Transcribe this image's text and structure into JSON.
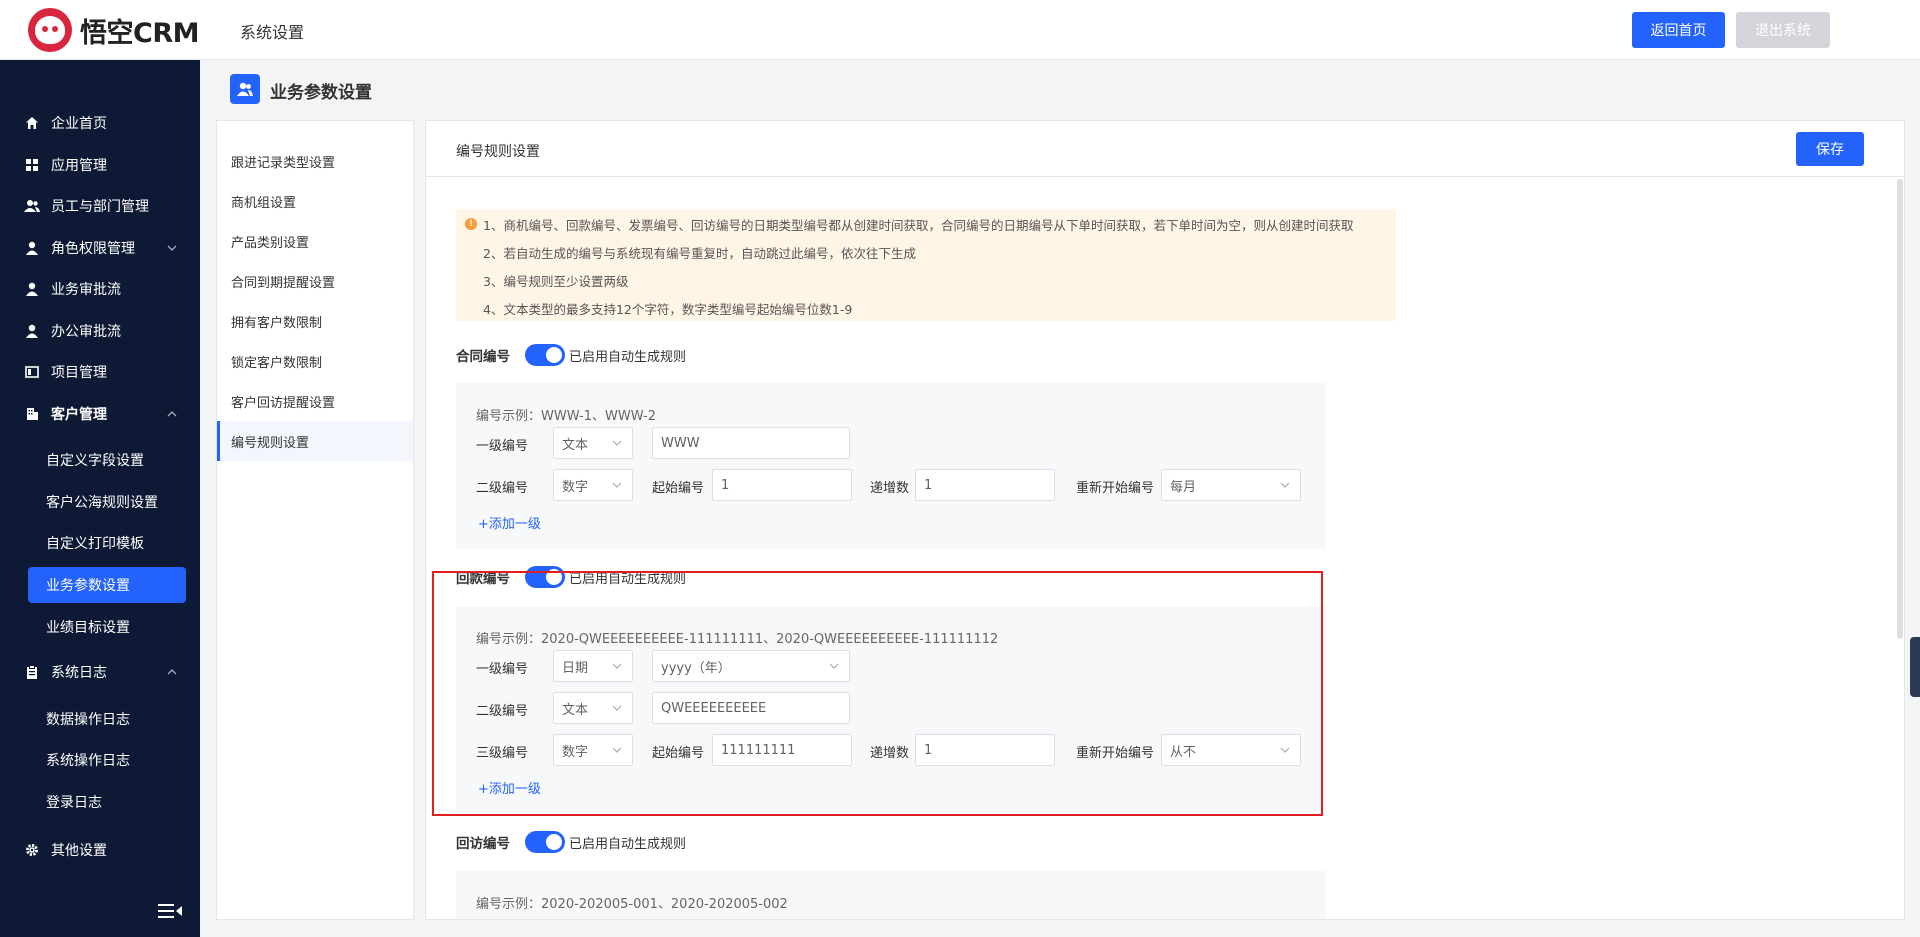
{
  "header": {
    "logo_text": "悟空CRM",
    "title": "系统设置",
    "back_label": "返回首页",
    "logout_label": "退出系统"
  },
  "sidebar": {
    "items": [
      {
        "label": "企业首页",
        "icon": "home-icon"
      },
      {
        "label": "应用管理",
        "icon": "grid-icon"
      },
      {
        "label": "员工与部门管理",
        "icon": "users-icon"
      },
      {
        "label": "角色权限管理",
        "icon": "user-icon"
      },
      {
        "label": "业务审批流",
        "icon": "user-icon"
      },
      {
        "label": "办公审批流",
        "icon": "user-icon"
      },
      {
        "label": "项目管理",
        "icon": "project-icon"
      },
      {
        "label": "客户管理",
        "icon": "building-icon"
      },
      {
        "label": "系统日志",
        "icon": "clipboard-icon"
      },
      {
        "label": "其他设置",
        "icon": "gear-icon"
      }
    ],
    "customer_sub": [
      "自定义字段设置",
      "客户公海规则设置",
      "自定义打印模板",
      "业务参数设置",
      "业绩目标设置"
    ],
    "log_sub": [
      "数据操作日志",
      "系统操作日志",
      "登录日志"
    ]
  },
  "page": {
    "title": "业务参数设置"
  },
  "settings_menu": [
    "跟进记录类型设置",
    "商机组设置",
    "产品类别设置",
    "合同到期提醒设置",
    "拥有客户数限制",
    "锁定客户数限制",
    "客户回访提醒设置",
    "编号规则设置"
  ],
  "panel": {
    "title": "编号规则设置",
    "save_label": "保存",
    "notice": [
      "1、商机编号、回款编号、发票编号、回访编号的日期类型编号都从创建时间获取，合同编号的日期编号从下单时间获取，若下单时间为空，则从创建时间获取",
      "2、若自动生成的编号与系统现有编号重复时，自动跳过此编号，依次往下生成",
      "3、编号规则至少设置两级",
      "4、文本类型的最多支持12个字符，数字类型编号起始编号位数1-9"
    ],
    "switch_label": "已启用自动生成规则",
    "add_level": "+添加一级",
    "labels": {
      "level1": "一级编号",
      "level2": "二级编号",
      "level3": "三级编号",
      "start": "起始编号",
      "step": "递增数",
      "restart": "重新开始编号"
    },
    "contract": {
      "name": "合同编号",
      "example": "编号示例：WWW-1、WWW-2",
      "l1_type": "文本",
      "l1_value": "WWW",
      "l2_type": "数字",
      "l2_start": "1",
      "l2_step": "1",
      "l2_restart": "每月"
    },
    "payment": {
      "name": "回款编号",
      "example": "编号示例：2020-QWEEEEEEEEEE-111111111、2020-QWEEEEEEEEEE-111111112",
      "l1_type": "日期",
      "l1_value": "yyyy（年）",
      "l2_type": "文本",
      "l2_value": "QWEEEEEEEEEE",
      "l3_type": "数字",
      "l3_start": "111111111",
      "l3_step": "1",
      "l3_restart": "从不"
    },
    "visit": {
      "name": "回访编号",
      "example": "编号示例：2020-202005-001、2020-202005-002"
    }
  },
  "colors": {
    "primary": "#2362fb",
    "sidebar_bg": "#0e1a35",
    "highlight": "#e02020",
    "notice_bg": "#fff5e6"
  }
}
